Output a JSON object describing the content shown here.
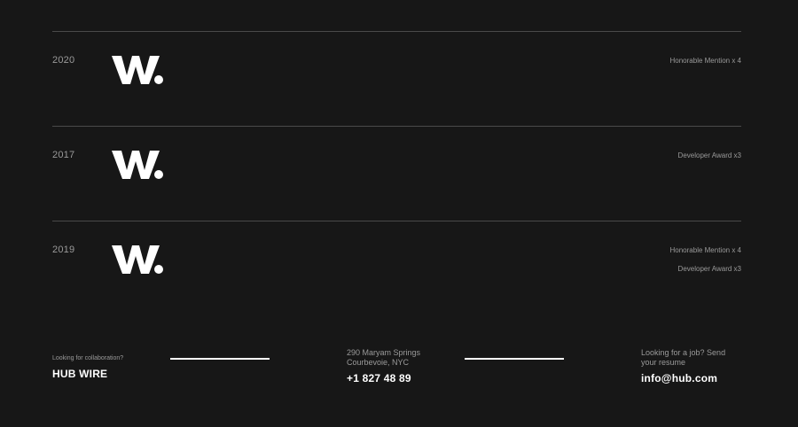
{
  "awards": [
    {
      "year": "2020",
      "logo_text": "W.",
      "items": [
        "Honorable Mention x 4"
      ]
    },
    {
      "year": "2017",
      "logo_text": "W.",
      "items": [
        "Developer Award x3"
      ]
    },
    {
      "year": "2019",
      "logo_text": "W.",
      "items": [
        "Honorable Mention x 4",
        "Developer Award x3"
      ]
    }
  ],
  "footer": {
    "collab_label": "Looking for collaboration?",
    "collab_value": "HUB WIRE",
    "address_line1": "290 Maryam Springs",
    "address_line2": "Courbevoie, NYC",
    "phone": "+1 827 48 89",
    "job_label_line1": "Looking for a job? Send",
    "job_label_line2": "your resume",
    "email": "info@hub.com"
  },
  "colors": {
    "background": "#171717",
    "divider": "#4a4a4a",
    "muted_text": "#9a9a9a",
    "primary_text": "#ffffff"
  }
}
